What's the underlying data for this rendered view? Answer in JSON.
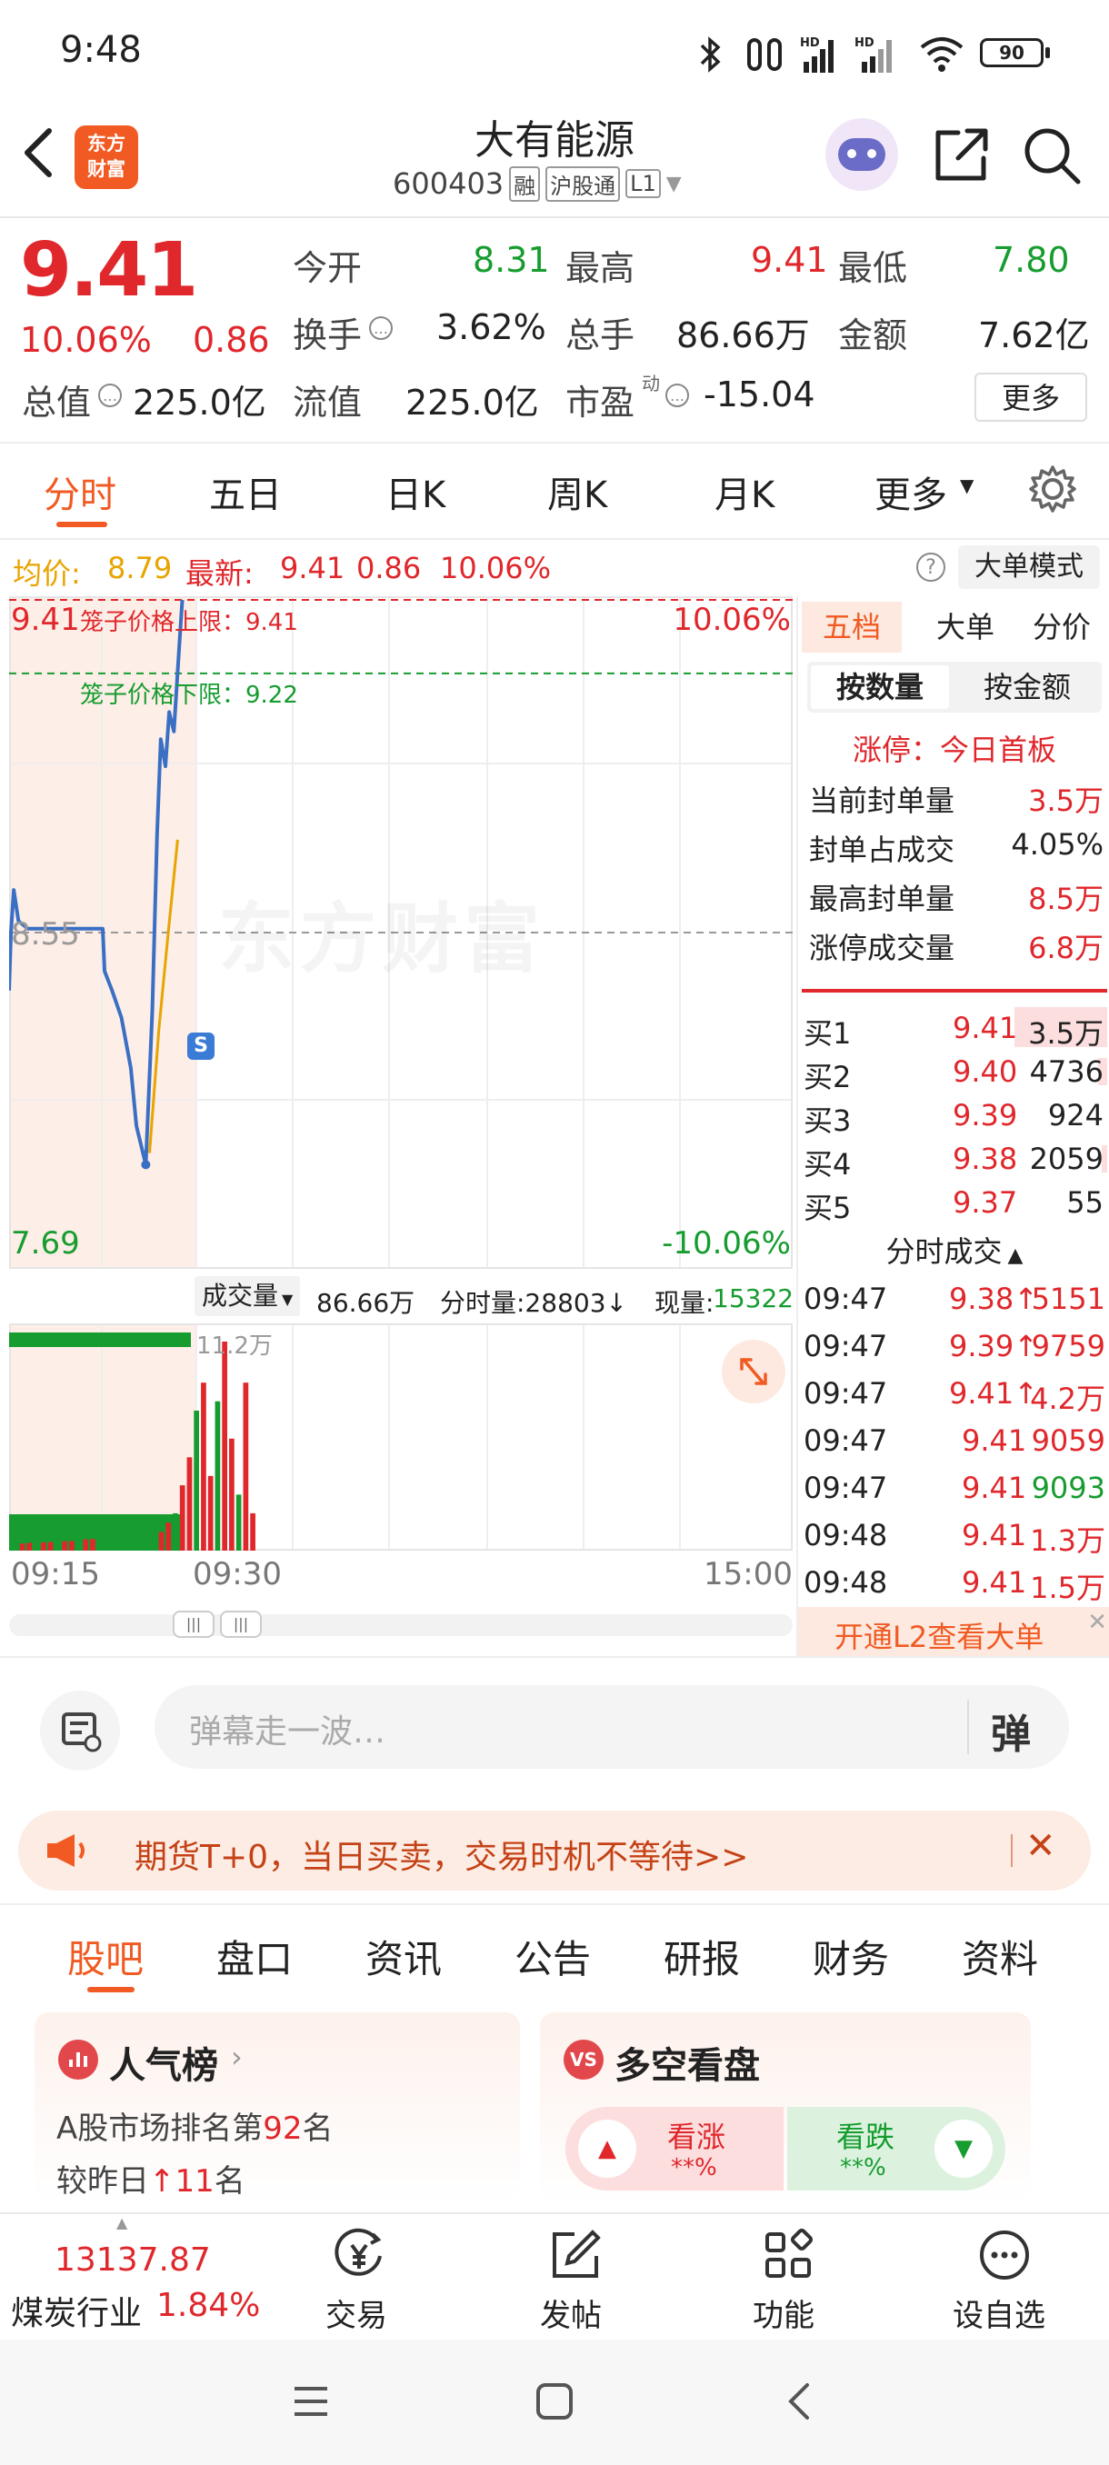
{
  "status_bar": {
    "time": "9:48",
    "battery": "90",
    "network": "HD"
  },
  "header": {
    "title": "大有能源",
    "code": "600403",
    "badge_margin": "融",
    "badge_connect": "沪股通",
    "badge_level": "L1",
    "logo_line1": "东方",
    "logo_line2": "财富"
  },
  "quote": {
    "price": "9.41",
    "change_pct": "10.06%",
    "change": "0.86",
    "open_label": "今开",
    "open": "8.31",
    "high_label": "最高",
    "high": "9.41",
    "low_label": "最低",
    "low": "7.80",
    "turnover_label": "换手",
    "turnover": "3.62%",
    "volume_label": "总手",
    "volume": "86.66万",
    "amount_label": "金额",
    "amount": "7.62亿",
    "mktcap_label": "总值",
    "mktcap": "225.0亿",
    "float_label": "流值",
    "float": "225.0亿",
    "pe_label": "市盈",
    "pe_sup": "动",
    "pe": "-15.04",
    "more_button": "更多"
  },
  "chart_tabs": [
    "分时",
    "五日",
    "日K",
    "周K",
    "月K",
    "更多"
  ],
  "info_line": {
    "avg_label": "均价:",
    "avg": "8.79",
    "latest_label": "最新:",
    "latest": "9.41",
    "chg": "0.86",
    "pct": "10.06%",
    "help_icon": "?",
    "big_order_mode": "大单模式"
  },
  "chart": {
    "top_price": "9.41",
    "top_pct": "10.06%",
    "bottom_price": "7.69",
    "bottom_pct": "-10.06%",
    "mid_price": "8.55",
    "upper_limit_label": "笼子价格上限：9.41",
    "lower_limit_label": "笼子价格下限：9.22",
    "watermark": "东方财富",
    "s_marker": "S"
  },
  "volume_bar": {
    "type_label": "成交量",
    "type_value": "86.66万",
    "tick_label": "分时量:28803↓",
    "now_label": "现量:",
    "now_value": "15322",
    "max_label": "11.2万"
  },
  "time_axis": {
    "start": "09:15",
    "mid": "09:30",
    "end": "15:00"
  },
  "right_panel": {
    "tabs": [
      "五档",
      "大单",
      "分价"
    ],
    "subtabs": [
      "按数量",
      "按金额"
    ],
    "limit_status": "涨停：今日首板",
    "stats": [
      {
        "label": "当前封单量",
        "value": "3.5万"
      },
      {
        "label": "封单占成交",
        "value": "4.05%"
      },
      {
        "label": "最高封单量",
        "value": "8.5万"
      },
      {
        "label": "涨停成交量",
        "value": "6.8万"
      }
    ],
    "bids": [
      {
        "label": "买1",
        "price": "9.41",
        "qty": "3.5万"
      },
      {
        "label": "买2",
        "price": "9.40",
        "qty": "4736"
      },
      {
        "label": "买3",
        "price": "9.39",
        "qty": "924"
      },
      {
        "label": "买4",
        "price": "9.38",
        "qty": "2059"
      },
      {
        "label": "买5",
        "price": "9.37",
        "qty": "55"
      }
    ],
    "trades_title": "分时成交",
    "trades": [
      {
        "time": "09:47",
        "price": "9.38↑",
        "qty": "5151"
      },
      {
        "time": "09:47",
        "price": "9.39↑",
        "qty": "9759"
      },
      {
        "time": "09:47",
        "price": "9.41↑",
        "qty": "4.2万"
      },
      {
        "time": "09:47",
        "price": "9.41",
        "qty": "9059"
      },
      {
        "time": "09:47",
        "price": "9.41",
        "qty": "9093"
      },
      {
        "time": "09:48",
        "price": "9.41",
        "qty": "1.3万"
      },
      {
        "time": "09:48",
        "price": "9.41",
        "qty": "1.5万"
      }
    ],
    "l2_banner": "开通L2查看大单"
  },
  "danmaku": {
    "placeholder": "弹幕走一波…",
    "toggle_label": "弹"
  },
  "ad_banner": {
    "text": "期货T+0，当日买卖，交易时机不等待>>"
  },
  "section_tabs": [
    "股吧",
    "盘口",
    "资讯",
    "公告",
    "研报",
    "财务",
    "资料"
  ],
  "cards": {
    "popularity": {
      "title": "人气榜",
      "line1_prefix": "A股市场排名第",
      "rank": "92",
      "line1_suffix": "名",
      "line2_prefix": "较昨日",
      "delta": "11",
      "line2_suffix": "名"
    },
    "sentiment": {
      "title": "多空看盘",
      "bull_label": "看涨",
      "bull_value": "**%",
      "bear_label": "看跌",
      "bear_value": "**%"
    }
  },
  "bottom_bar": {
    "index_value": "13137.87",
    "industry": "煤炭行业",
    "industry_pct": "1.84%",
    "items": [
      "交易",
      "发帖",
      "功能",
      "设自选"
    ]
  },
  "chart_data": {
    "type": "line",
    "title": "",
    "ylim": [
      7.69,
      9.41
    ],
    "x_ticks": [
      "09:15",
      "09:30",
      "15:00"
    ],
    "price_series": [
      {
        "t": 0,
        "p": 8.4
      },
      {
        "t": 0.2,
        "p": 8.55
      },
      {
        "t": 0.5,
        "p": 8.66
      },
      {
        "t": 1,
        "p": 8.58
      },
      {
        "t": 2,
        "p": 8.56
      },
      {
        "t": 4,
        "p": 8.56
      },
      {
        "t": 6,
        "p": 8.56
      },
      {
        "t": 8,
        "p": 8.56
      },
      {
        "t": 10,
        "p": 8.56
      },
      {
        "t": 10.2,
        "p": 8.45
      },
      {
        "t": 11,
        "p": 8.4
      },
      {
        "t": 12,
        "p": 8.33
      },
      {
        "t": 13,
        "p": 8.2
      },
      {
        "t": 13.6,
        "p": 8.05
      },
      {
        "t": 14.6,
        "p": 7.95
      },
      {
        "t": 15.3,
        "p": 8.35
      },
      {
        "t": 15.8,
        "p": 8.8
      },
      {
        "t": 16.2,
        "p": 9.05
      },
      {
        "t": 16.7,
        "p": 8.98
      },
      {
        "t": 17.1,
        "p": 9.12
      },
      {
        "t": 17.6,
        "p": 9.07
      },
      {
        "t": 18.2,
        "p": 9.3
      },
      {
        "t": 18.5,
        "p": 9.41
      }
    ],
    "avg_series": [
      {
        "t": 15.0,
        "p": 7.98
      },
      {
        "t": 16.0,
        "p": 8.3
      },
      {
        "t": 17.0,
        "p": 8.55
      },
      {
        "t": 18.0,
        "p": 8.79
      }
    ],
    "volume_values": [
      0.35,
      0.38,
      0.42,
      0.4,
      0.44,
      0.46,
      0.45,
      0.5,
      0.52,
      0.55,
      0.6,
      0.62,
      0.8,
      1.0,
      1.5,
      2.0,
      3.5,
      5.0,
      7.5,
      9.0,
      4.0,
      8.0,
      11.2,
      6.0,
      3.0,
      9.0,
      2.0
    ]
  }
}
